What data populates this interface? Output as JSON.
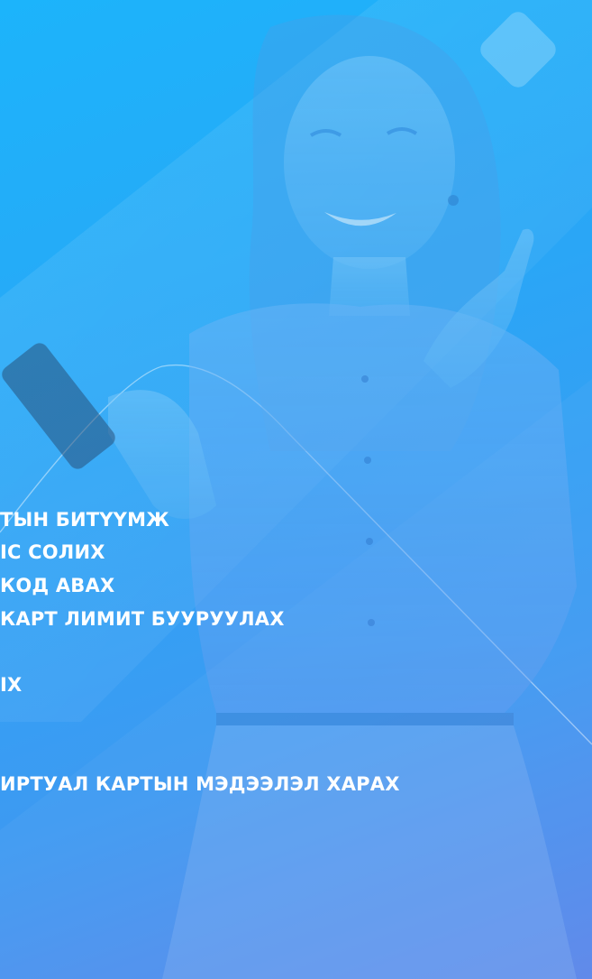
{
  "hero": {
    "background_gradient": [
      "#1cb4fb",
      "#2aa6f6",
      "#3d9af2",
      "#5b86ea"
    ],
    "image": "smiling-woman-holding-phone",
    "decoration": "rotated-square-icon"
  },
  "features": [
    {
      "id": "card-security",
      "label": "ТЫН БИТҮҮМЖ"
    },
    {
      "id": "change-pin",
      "label": "ІС СОЛИХ"
    },
    {
      "id": "get-code",
      "label": "КОД АВАХ"
    },
    {
      "id": "reduce-limit",
      "label": "КАРТ ЛИМИТ БУУРУУЛАХ"
    },
    {
      "id": "item-5",
      "label": "ІХ"
    },
    {
      "id": "view-virtual-card",
      "label": "ИРТУАЛ КАРТЫН МЭДЭЭЛЭЛ ХАРАХ"
    }
  ]
}
